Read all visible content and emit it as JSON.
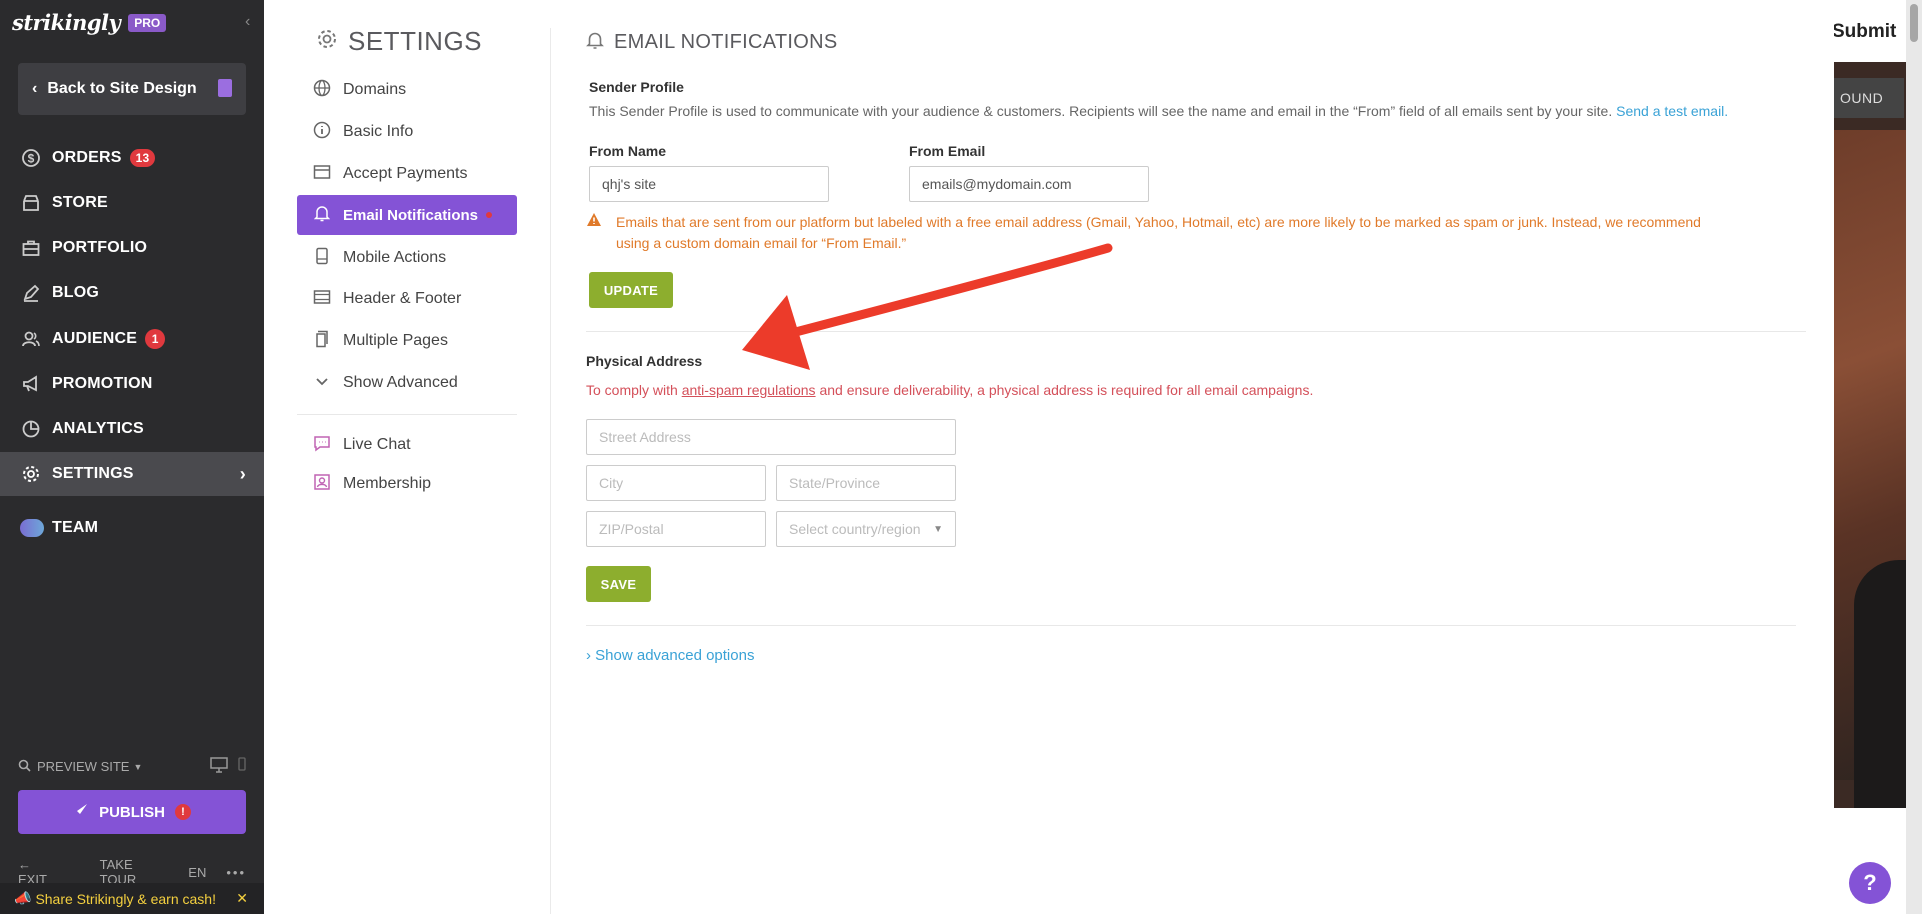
{
  "brand": {
    "name": "strikingly",
    "badge": "PRO"
  },
  "left_nav": {
    "back_label": "Back to Site Design",
    "items": [
      {
        "label": "ORDERS",
        "badge": "13",
        "icon": "dollar-icon"
      },
      {
        "label": "STORE",
        "icon": "store-icon"
      },
      {
        "label": "PORTFOLIO",
        "icon": "briefcase-icon"
      },
      {
        "label": "BLOG",
        "icon": "pen-icon"
      },
      {
        "label": "AUDIENCE",
        "badge": "1",
        "icon": "users-icon"
      },
      {
        "label": "PROMOTION",
        "icon": "megaphone-icon"
      },
      {
        "label": "ANALYTICS",
        "icon": "pie-chart-icon"
      },
      {
        "label": "SETTINGS",
        "icon": "gear-icon",
        "active": true
      },
      {
        "label": "TEAM",
        "icon": "team-icon"
      }
    ],
    "preview_label": "PREVIEW SITE",
    "publish_label": "PUBLISH",
    "footer": {
      "exit": "EXIT",
      "tour": "TAKE TOUR",
      "lang": "EN"
    },
    "share_text": "Share Strikingly & earn cash!"
  },
  "settings_panel": {
    "title": "SETTINGS",
    "items": [
      {
        "label": "Domains",
        "icon": "globe-icon"
      },
      {
        "label": "Basic Info",
        "icon": "info-icon"
      },
      {
        "label": "Accept Payments",
        "icon": "payment-card-icon"
      },
      {
        "label": "Email Notifications",
        "icon": "bell-icon",
        "active": true
      },
      {
        "label": "Mobile Actions",
        "icon": "mobile-icon"
      },
      {
        "label": "Header & Footer",
        "icon": "layout-icon"
      },
      {
        "label": "Multiple Pages",
        "icon": "pages-icon"
      },
      {
        "label": "Show Advanced",
        "icon": "chevron-down-icon"
      },
      {
        "label": "Live Chat",
        "icon": "chat-icon"
      },
      {
        "label": "Membership",
        "icon": "member-icon"
      }
    ]
  },
  "main": {
    "title": "EMAIL NOTIFICATIONS",
    "sender": {
      "heading": "Sender Profile",
      "description": "This Sender Profile is used to communicate with your audience & customers. Recipients will see the name and email in the “From” field of all emails sent by your site.",
      "test_link": "Send a test email.",
      "from_name_label": "From Name",
      "from_name_value": "qhj's site",
      "from_email_label": "From Email",
      "from_email_placeholder": "emails@mydomain.com",
      "warning_line1": "Emails that are sent from our platform but labeled with a free email address (Gmail, Yahoo, Hotmail, etc) are more likely to be marked as spam or junk. Instead, we recommend",
      "warning_line2": "using a custom domain email for “From Email.”",
      "update_label": "UPDATE"
    },
    "address": {
      "heading": "Physical Address",
      "comply_pre": "To comply with",
      "comply_link": "anti-spam regulations",
      "comply_post": "and ensure deliverability, a physical address is required for all email campaigns.",
      "street_placeholder": "Street Address",
      "city_placeholder": "City",
      "state_placeholder": "State/Province",
      "zip_placeholder": "ZIP/Postal",
      "country_placeholder": "Select country/region",
      "save_label": "SAVE"
    },
    "advanced_link": "Show advanced options"
  },
  "preview_strip": {
    "submit": "Submit",
    "band": "OUND"
  },
  "help_label": "?",
  "colors": {
    "accent": "#8453d6",
    "sidebar": "#2b2b2d",
    "green_button": "#8dae2e",
    "warning": "#e07a2a",
    "link": "#3aa2d6",
    "annotation_arrow": "#ec3b2a"
  }
}
